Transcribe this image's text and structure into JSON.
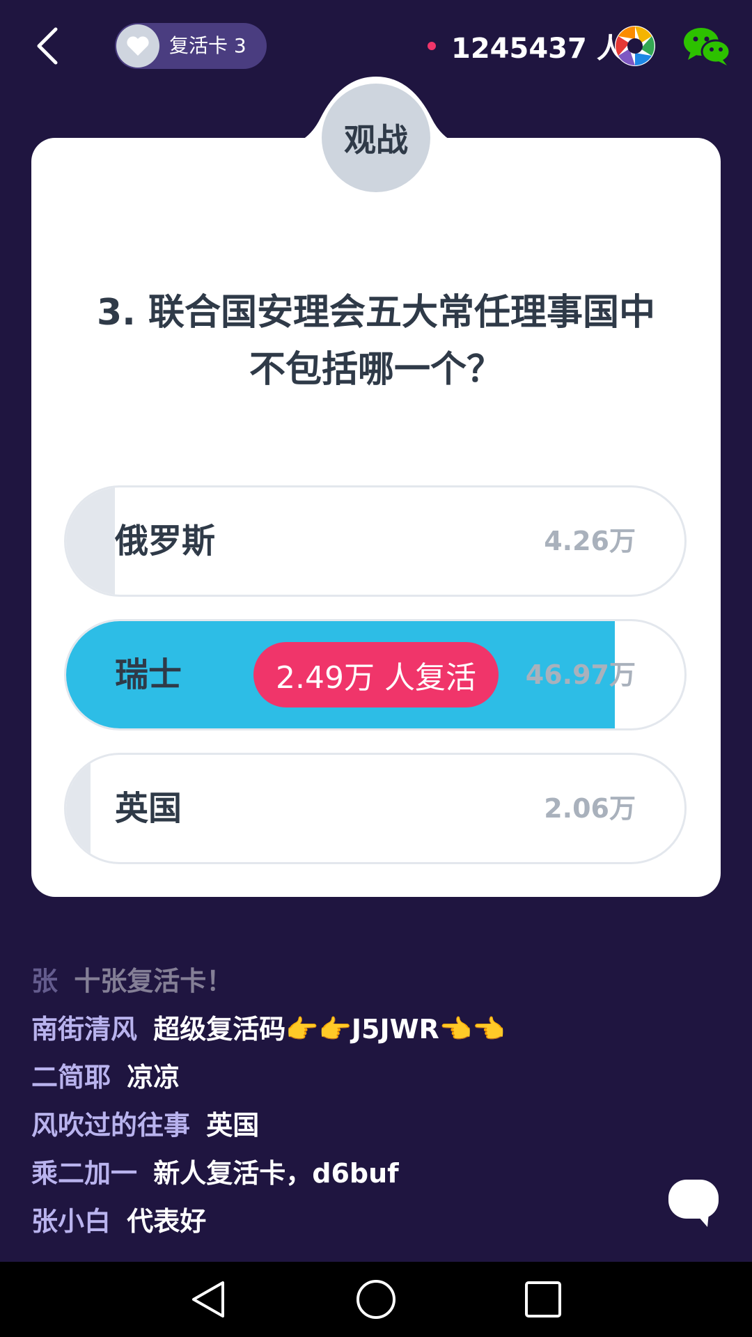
{
  "header": {
    "revive_card_label": "复活卡 3",
    "online_count": "1245437 人",
    "icons": {
      "back": "back-arrow-icon",
      "heart": "heart-icon",
      "camera": "camera-aperture-icon",
      "share": "wechat-icon"
    }
  },
  "quiz": {
    "spectate_label": "观战",
    "question_line1": "3. 联合国安理会五大常任理事国中",
    "question_line2": "不包括哪一个？",
    "options": [
      {
        "label": "俄罗斯",
        "count": "4.26万",
        "share": 0.08
      },
      {
        "label": "瑞士",
        "count": "46.97万",
        "share": 0.88
      },
      {
        "label": "英国",
        "count": "2.06万",
        "share": 0.04
      }
    ],
    "revive_badge": "2.49万 人复活",
    "selected_color": "#2dbde6",
    "badge_color": "#f0356a"
  },
  "comments": [
    {
      "user": "张",
      "msg": "十张复活卡！"
    },
    {
      "user": "南街清风",
      "msg": "超级复活码👉👉J5JWR👈👈"
    },
    {
      "user": "二简耶",
      "msg": "凉凉"
    },
    {
      "user": "风吹过的往事",
      "msg": "英国"
    },
    {
      "user": "乘二加一",
      "msg": "新人复活卡，d6buf"
    },
    {
      "user": "张小白",
      "msg": "代表好"
    }
  ],
  "navbar": {
    "icons": [
      "nav-back-icon",
      "nav-home-icon",
      "nav-recents-icon"
    ]
  }
}
